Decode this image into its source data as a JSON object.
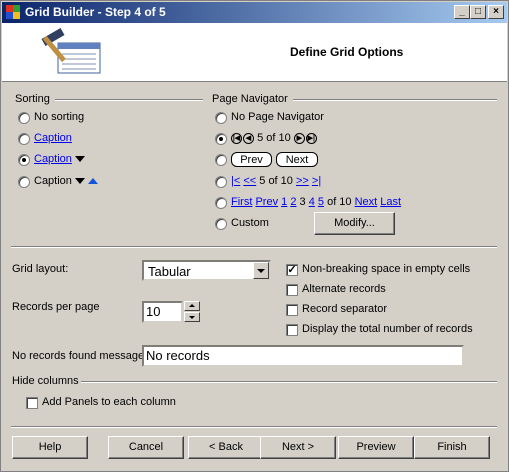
{
  "window": {
    "title": "Grid Builder - Step 4 of 5"
  },
  "header": {
    "title": "Define Grid Options",
    "icon": "hammer-grid-icon"
  },
  "sorting": {
    "label": "Sorting",
    "options": [
      "No sorting",
      "Caption",
      "Caption",
      "Caption"
    ],
    "selected_index": 2
  },
  "navigator": {
    "label": "Page Navigator",
    "selected_index": 1,
    "no_nav": "No Page Navigator",
    "icons_text": "5 of 10",
    "prev": "Prev",
    "next": "Next",
    "first_sym": "|<",
    "prev_sym": "<<",
    "mid_text": "5 of 10",
    "next_sym": ">>",
    "last_sym": ">|",
    "first": "First",
    "prevw": "Prev",
    "p1": "1",
    "p2": "2",
    "p3": "3",
    "p4": "4",
    "p5": "5",
    "of10": "of 10",
    "nextw": "Next",
    "lastw": "Last",
    "custom": "Custom",
    "modify": "Modify..."
  },
  "layout": {
    "label": "Grid layout:",
    "value": "Tabular"
  },
  "records": {
    "label": "Records per page",
    "value": "10"
  },
  "options": [
    {
      "label": "Non-breaking space in empty cells",
      "checked": true
    },
    {
      "label": "Alternate records",
      "checked": false
    },
    {
      "label": "Record separator",
      "checked": false
    },
    {
      "label": "Display the total number of records",
      "checked": false
    }
  ],
  "norecords": {
    "label": "No records found message",
    "value": "No records"
  },
  "hide": {
    "label": "Hide columns",
    "panels_label": "Add Panels to each column",
    "checked": false
  },
  "buttons": {
    "help": "Help",
    "cancel": "Cancel",
    "back": "< Back",
    "next": "Next >",
    "preview": "Preview",
    "finish": "Finish"
  }
}
